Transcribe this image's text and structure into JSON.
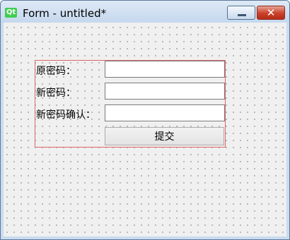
{
  "window": {
    "logo": "Qt",
    "title": "Form - untitled*",
    "minimize_icon": "minimize-icon",
    "close_icon": "close-icon",
    "close_glyph": "✕"
  },
  "form": {
    "old_password_label": "原密码：",
    "new_password_label": "新密码：",
    "confirm_password_label": "新密码确认：",
    "old_password_value": "",
    "new_password_value": "",
    "confirm_password_value": "",
    "submit_label": "提交"
  },
  "colors": {
    "layout_border": "#e06666",
    "titlebar": "#c9dbef",
    "close_button": "#c9412a",
    "qt_logo": "#41cd52"
  }
}
